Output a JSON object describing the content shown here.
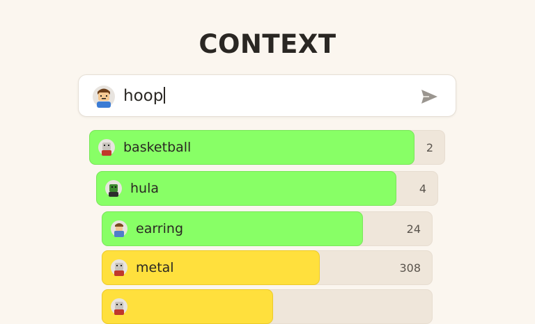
{
  "title": "CONTEXT",
  "guess_input": {
    "value": "hoop"
  },
  "colors": {
    "close": "#88ff66",
    "medium": "#ffe03d",
    "track": "#efe6da"
  },
  "guesses": [
    {
      "word": "basketball",
      "rank": "2",
      "color": "green",
      "closeness": 0.91
    },
    {
      "word": "hula",
      "rank": "4",
      "color": "green",
      "closeness": 0.87
    },
    {
      "word": "earring",
      "rank": "24",
      "color": "green",
      "closeness": 0.79
    },
    {
      "word": "metal",
      "rank": "308",
      "color": "yellow",
      "closeness": 0.66
    },
    {
      "word": "",
      "rank": "",
      "color": "yellow",
      "closeness": 0.5
    }
  ]
}
